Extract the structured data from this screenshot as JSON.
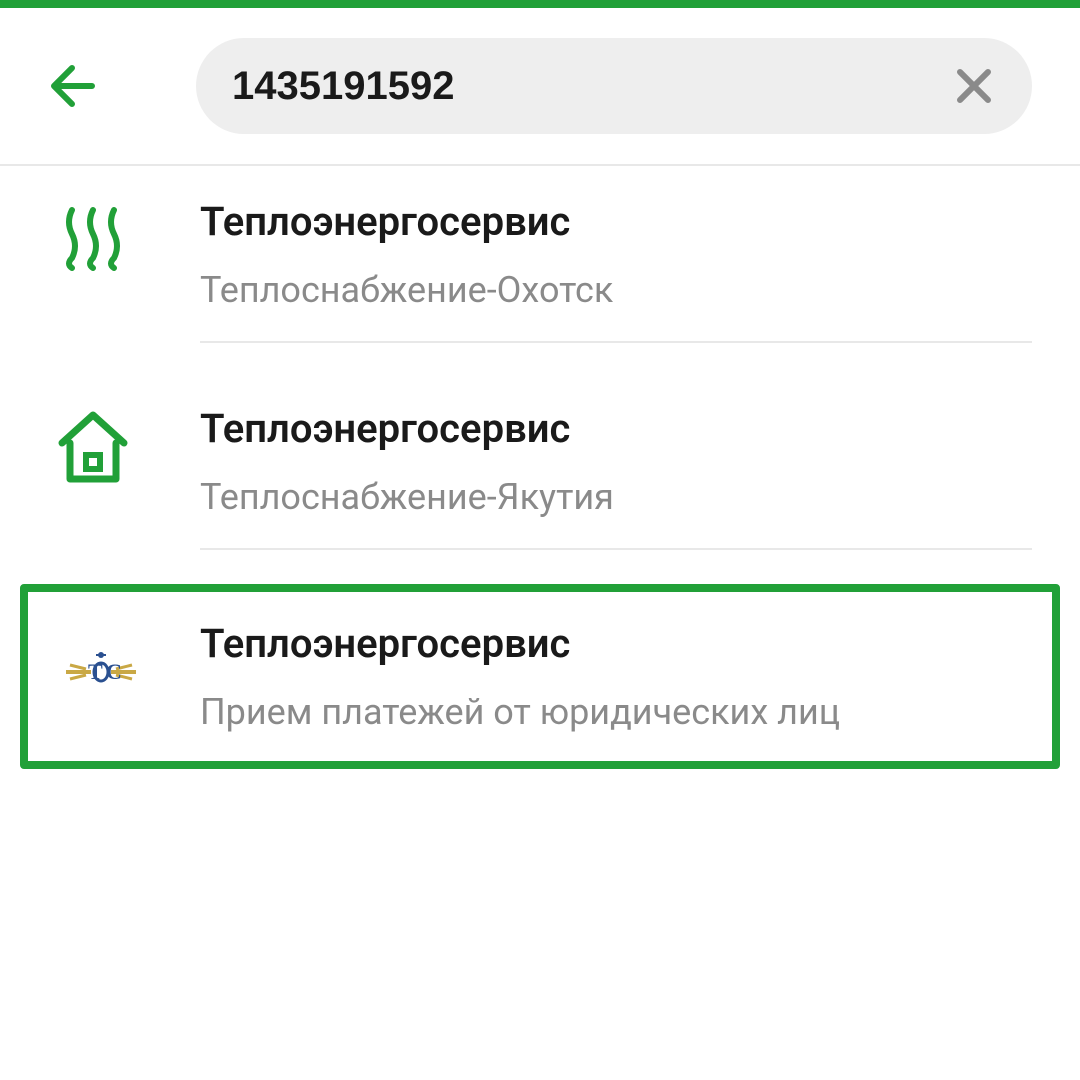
{
  "search": {
    "value": "1435191592"
  },
  "results": [
    {
      "title": "Теплоэнергосервис",
      "subtitle": "Теплоснабжение-Охотск",
      "icon": "heat"
    },
    {
      "title": "Теплоэнергосервис",
      "subtitle": "Теплоснабжение-Якутия",
      "icon": "house"
    },
    {
      "title": "Теплоэнергосервис",
      "subtitle": "Прием платежей от юридических лиц",
      "icon": "logo"
    }
  ]
}
